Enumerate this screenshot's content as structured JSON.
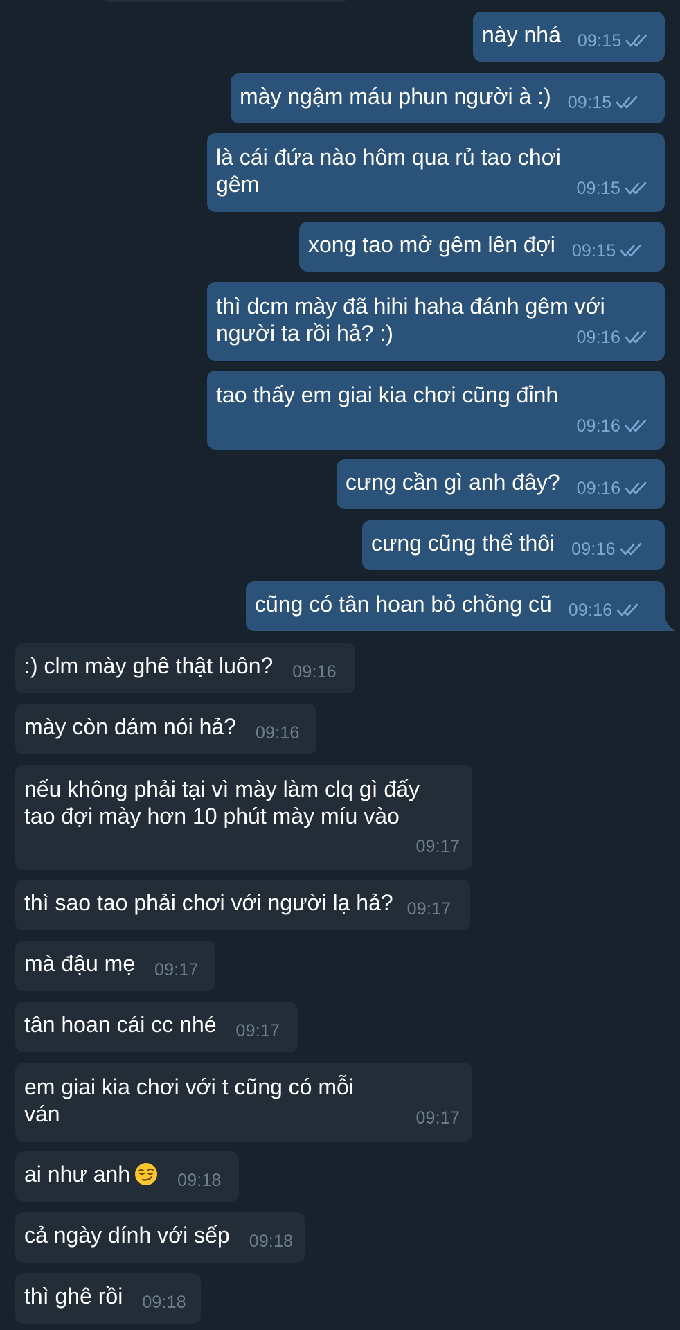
{
  "messages": [
    {
      "id": 1,
      "dir": "out",
      "text": "này nhá",
      "time": "09:15",
      "status": "read"
    },
    {
      "id": 2,
      "dir": "out",
      "text": "mày ngậm máu phun người à :)",
      "time": "09:15",
      "status": "read"
    },
    {
      "id": 3,
      "dir": "out",
      "text": "là cái đứa nào hôm qua rủ tao chơi gêm",
      "time": "09:15",
      "status": "read"
    },
    {
      "id": 4,
      "dir": "out",
      "text": "xong tao mở gêm lên đợi",
      "time": "09:15",
      "status": "read"
    },
    {
      "id": 5,
      "dir": "out",
      "text": "thì dcm mày đã hihi haha đánh gêm với người ta rồi hả? :)",
      "time": "09:16",
      "status": "read"
    },
    {
      "id": 6,
      "dir": "out",
      "text": "tao thấy em giai kia chơi cũng đỉnh",
      "time": "09:16",
      "status": "read"
    },
    {
      "id": 7,
      "dir": "out",
      "text": "cưng cần gì anh đây?",
      "time": "09:16",
      "status": "read"
    },
    {
      "id": 8,
      "dir": "out",
      "text": "cưng cũng thế thôi",
      "time": "09:16",
      "status": "read"
    },
    {
      "id": 9,
      "dir": "out",
      "text": "cũng có tân hoan bỏ chồng cũ",
      "time": "09:16",
      "status": "read"
    },
    {
      "id": 10,
      "dir": "in",
      "text": ":) clm mày ghê thật luôn?",
      "time": "09:16"
    },
    {
      "id": 11,
      "dir": "in",
      "text": "mày còn dám nói hả?",
      "time": "09:16"
    },
    {
      "id": 12,
      "dir": "in",
      "text": "nếu không phải tại vì mày làm clq gì đấy tao đợi mày hơn 10 phút mày míu vào",
      "time": "09:17"
    },
    {
      "id": 13,
      "dir": "in",
      "text": "thì sao tao phải chơi với người lạ hả?",
      "time": "09:17"
    },
    {
      "id": 14,
      "dir": "in",
      "text": "mà đậu mẹ",
      "time": "09:17"
    },
    {
      "id": 15,
      "dir": "in",
      "text": "tân hoan cái cc nhé",
      "time": "09:17"
    },
    {
      "id": 16,
      "dir": "in",
      "text": "em giai kia chơi với t cũng có mỗi ván",
      "time": "09:17"
    },
    {
      "id": 17,
      "dir": "in",
      "text": "ai như anh",
      "time": "09:18",
      "emoji": "smirking-face"
    },
    {
      "id": 18,
      "dir": "in",
      "text": "cả ngày dính với sếp",
      "time": "09:18"
    },
    {
      "id": 19,
      "dir": "in",
      "text": "thì ghê rồi",
      "time": "09:18"
    }
  ],
  "colors": {
    "background": "#18222d",
    "outgoing_bubble": "#2b5278",
    "incoming_bubble": "#222d38",
    "outgoing_time": "#7da8d3",
    "incoming_time": "#6d7f8f"
  }
}
